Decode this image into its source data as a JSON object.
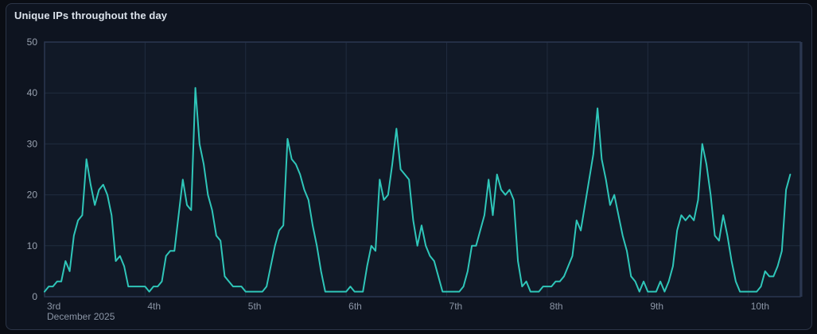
{
  "panel": {
    "title": "Unique IPs throughout the day"
  },
  "colors": {
    "page_bg": "#0a0d14",
    "panel_bg": "#0e1420",
    "panel_border": "#2c3547",
    "plot_bg": "#111927",
    "grid": "#212c3f",
    "axis_frame": "#2b3750",
    "line": "#2fc6b9",
    "title_text": "#dbe2eb",
    "y_label_text": "#99a2b0",
    "x_label_text": "#8b95a5"
  },
  "chart_data": {
    "type": "line",
    "title": "Unique IPs throughout the day",
    "xlabel": "",
    "ylabel": "",
    "ylim": [
      0,
      50
    ],
    "y_ticks": [
      0,
      10,
      20,
      30,
      40,
      50
    ],
    "grid": true,
    "legend": false,
    "x_unit": "hours since 2025-12-03 00:00",
    "x_plot_max_hours": 180.4,
    "x_day_ticks": [
      {
        "hour": 0,
        "label": "3rd",
        "sub_label": "December 2025"
      },
      {
        "hour": 24,
        "label": "4th"
      },
      {
        "hour": 48,
        "label": "5th"
      },
      {
        "hour": 72,
        "label": "6th"
      },
      {
        "hour": 96,
        "label": "7th"
      },
      {
        "hour": 120,
        "label": "8th"
      },
      {
        "hour": 144,
        "label": "9th"
      },
      {
        "hour": 168,
        "label": "10th"
      }
    ],
    "series": [
      {
        "name": "Unique IPs",
        "color": "#2fc6b9",
        "start_hour": 0,
        "interval_hours": 1,
        "values": [
          1,
          2,
          2,
          3,
          3,
          7,
          5,
          12,
          15,
          16,
          27,
          22,
          18,
          21,
          22,
          20,
          16,
          7,
          8,
          6,
          2,
          2,
          2,
          2,
          2,
          1,
          2,
          2,
          3,
          8,
          9,
          9,
          16,
          23,
          18,
          17,
          41,
          30,
          26,
          20,
          17,
          12,
          11,
          4,
          3,
          2,
          2,
          2,
          1,
          1,
          1,
          1,
          1,
          2,
          6,
          10,
          13,
          14,
          31,
          27,
          26,
          24,
          21,
          19,
          14,
          10,
          5,
          1,
          1,
          1,
          1,
          1,
          1,
          2,
          1,
          1,
          1,
          6,
          10,
          9,
          23,
          19,
          20,
          26,
          33,
          25,
          24,
          23,
          15,
          10,
          14,
          10,
          8,
          7,
          4,
          1,
          1,
          1,
          1,
          1,
          2,
          5,
          10,
          10,
          13,
          16,
          23,
          16,
          24,
          21,
          20,
          21,
          19,
          7,
          2,
          3,
          1,
          1,
          1,
          2,
          2,
          2,
          3,
          3,
          4,
          6,
          8,
          15,
          13,
          18,
          23,
          28,
          37,
          27,
          23,
          18,
          20,
          16,
          12,
          9,
          4,
          3,
          1,
          3,
          1,
          1,
          1,
          3,
          1,
          3,
          6,
          13,
          16,
          15,
          16,
          15,
          19,
          30,
          26,
          20,
          12,
          11,
          16,
          12,
          7,
          3,
          1,
          1,
          1,
          1,
          1,
          2,
          5,
          4,
          4,
          6,
          9,
          21,
          24
        ]
      }
    ]
  }
}
